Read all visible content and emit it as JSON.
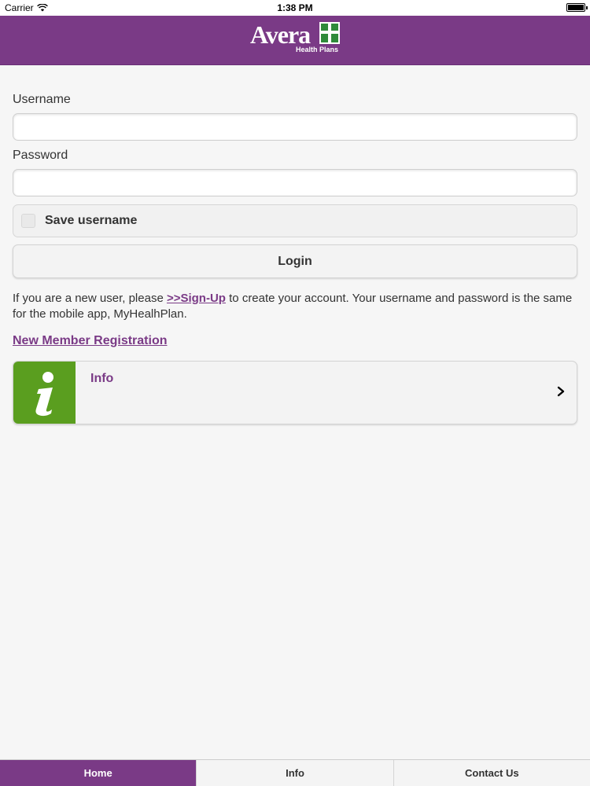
{
  "status_bar": {
    "carrier": "Carrier",
    "time": "1:38 PM",
    "icons": [
      "wifi-icon",
      "battery-icon"
    ]
  },
  "header": {
    "logo_text": "Avera",
    "logo_subtext": "Health Plans",
    "brand_color": "#7a3a86"
  },
  "login_form": {
    "username_label": "Username",
    "username_value": "",
    "password_label": "Password",
    "password_value": "",
    "save_username_label": "Save username",
    "login_button_label": "Login"
  },
  "help_text": {
    "prefix": "If you are a new user, please ",
    "signup_link": ">>Sign-Up",
    "suffix": " to create your account. Your username and password is the same for the mobile app, MyHealhPlan."
  },
  "new_member_link": "New Member Registration",
  "info_card": {
    "title": "Info",
    "icon": "info-icon",
    "thumb_color": "#5a9e1f"
  },
  "tab_bar": {
    "tabs": [
      {
        "label": "Home",
        "active": true
      },
      {
        "label": "Info",
        "active": false
      },
      {
        "label": "Contact Us",
        "active": false
      }
    ]
  }
}
